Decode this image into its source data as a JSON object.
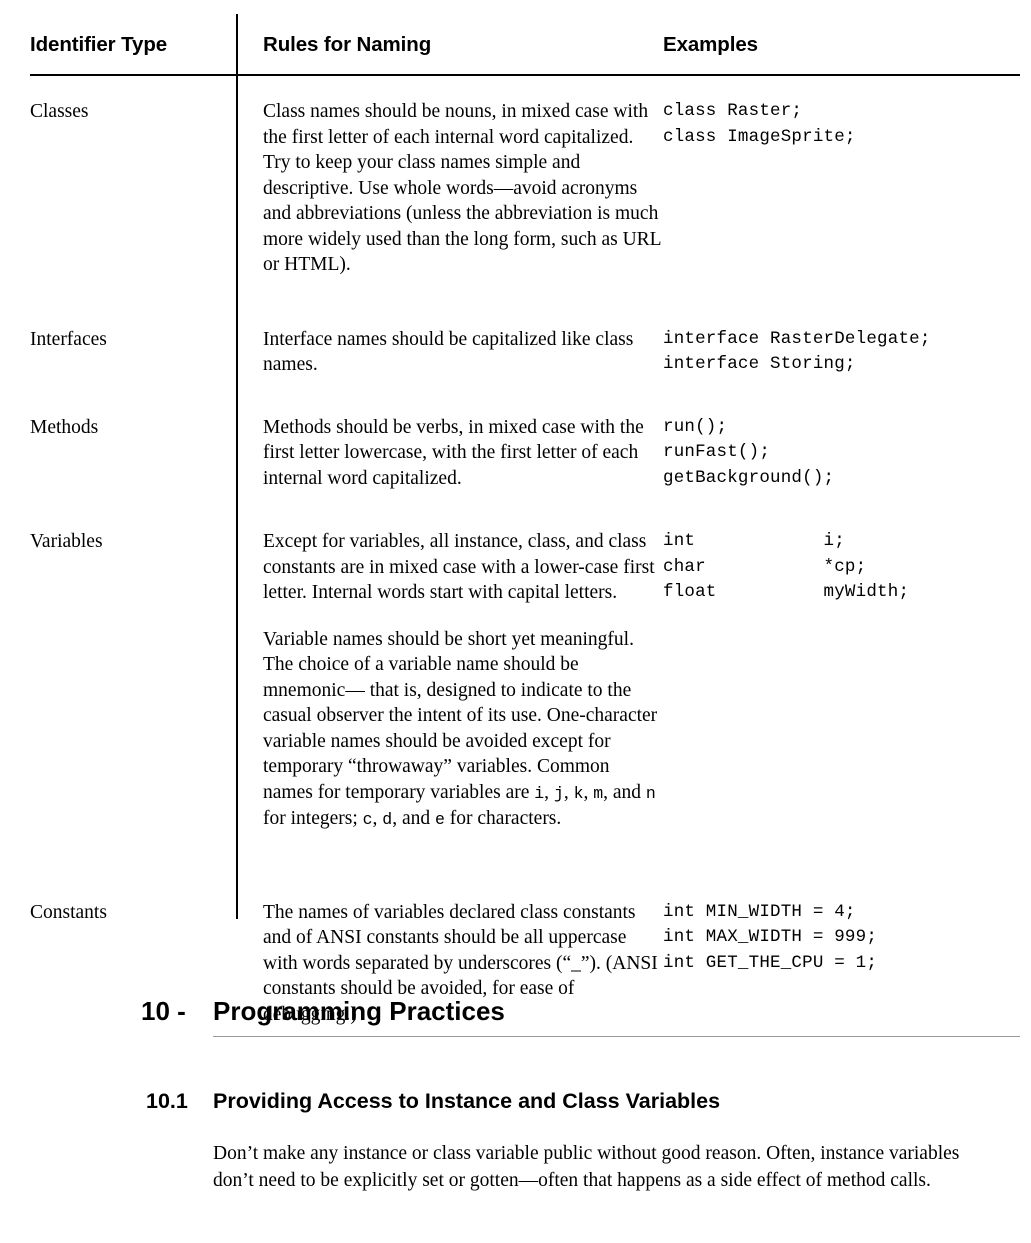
{
  "table": {
    "columns": [
      "Identifier Type",
      "Rules for Naming",
      "Examples"
    ],
    "rows": [
      {
        "type": "Classes",
        "rules": [
          "Class names should be nouns, in mixed case with the first letter of each internal word capitalized. Try to keep your class names simple and descriptive. Use whole words—avoid acronyms and abbreviations (unless the abbreviation is much more widely used than the long form, such as URL or HTML)."
        ],
        "examples": "class Raster;\nclass ImageSprite;"
      },
      {
        "type": "Interfaces",
        "rules": [
          "Interface names should be capitalized like class names."
        ],
        "examples": "interface RasterDelegate;\ninterface Storing;"
      },
      {
        "type": "Methods",
        "rules": [
          "Methods should be verbs, in mixed case with the first letter lowercase, with the first letter of each internal word capitalized."
        ],
        "examples": "run();\nrunFast();\ngetBackground();"
      },
      {
        "type": "Variables",
        "rules": [
          "Except for variables, all instance, class,  and class constants are in mixed case with a lower-case first letter. Internal words start with capital letters.",
          "Variable names should be short yet meaningful. The choice of a variable name should be mnemonic— that is, designed to indicate to the casual observer the intent of its use. One-character variable names should be avoided except for temporary “throwaway” variables. Common names for temporary variables are i, j, k, m, and n for integers; c, d, and e for characters."
        ],
        "rules_variables_segments": [
          {
            "text": "Variable names should be short yet meaningful. The choice of a variable name should be mnemonic— that is, designed to indicate to the casual observer the intent of its use. One-character variable names should be avoided except for temporary “throwaway” variables. Common names for temporary variables are ",
            "mono": false
          },
          {
            "text": "i",
            "mono": true
          },
          {
            "text": ", ",
            "mono": false
          },
          {
            "text": "j",
            "mono": true
          },
          {
            "text": ", ",
            "mono": false
          },
          {
            "text": "k",
            "mono": true
          },
          {
            "text": ", ",
            "mono": false
          },
          {
            "text": "m",
            "mono": true
          },
          {
            "text": ", and ",
            "mono": false
          },
          {
            "text": "n",
            "mono": true
          },
          {
            "text": " for integers; ",
            "mono": false
          },
          {
            "text": "c",
            "mono": true
          },
          {
            "text": ", ",
            "mono": false
          },
          {
            "text": "d",
            "mono": true
          },
          {
            "text": ", and ",
            "mono": false
          },
          {
            "text": "e",
            "mono": true
          },
          {
            "text": " for characters.",
            "mono": false
          }
        ],
        "examples": "int            i;\nchar           *cp;\nfloat          myWidth;"
      },
      {
        "type": "Constants",
        "rules": [
          "The names of variables declared class constants  and of ANSI constants should be all uppercase with words separated by underscores (“_”). (ANSI constants should be avoided, for ease of debugging.)"
        ],
        "examples": "int MIN_WIDTH = 4;\nint MAX_WIDTH = 999;\nint GET_THE_CPU = 1;"
      }
    ]
  },
  "chapter": {
    "number": "10 -",
    "title": "Programming Practices"
  },
  "subsection": {
    "number": "10.1",
    "title": "Providing Access to Instance and Class Variables"
  },
  "body": {
    "paragraph": "Don’t make any instance or class variable public without good reason. Often, instance variables don’t need to be explicitly set or gotten—often that happens as a side effect of method calls."
  }
}
